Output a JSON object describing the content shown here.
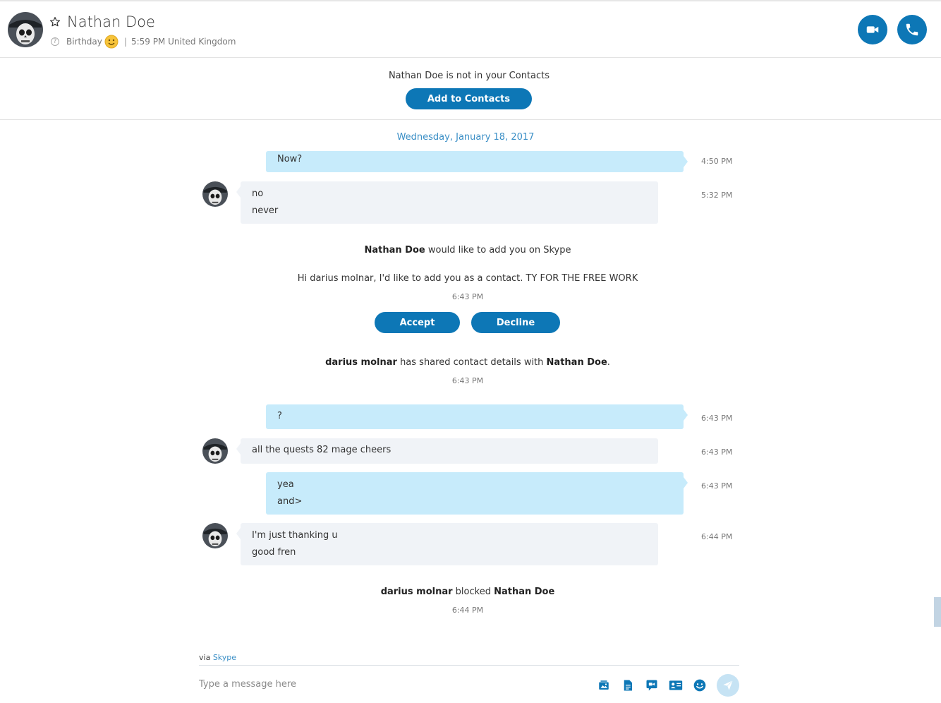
{
  "contact": {
    "name": "Nathan Doe",
    "status_label": "Birthday",
    "separator": "|",
    "local_time": "5:59 PM United Kingdom",
    "help_glyph": "?"
  },
  "banner": {
    "text": "Nathan Doe is not in your Contacts",
    "add_button": "Add to Contacts"
  },
  "date_separator": "Wednesday, January 18, 2017",
  "messages": [
    {
      "direction": "out",
      "lines": [
        "Now?"
      ],
      "time": "4:50 PM"
    },
    {
      "direction": "in",
      "lines": [
        "no",
        "never"
      ],
      "time": "5:32 PM"
    },
    {
      "direction": "out",
      "lines": [
        "?"
      ],
      "time": "6:43 PM"
    },
    {
      "direction": "in",
      "lines": [
        "all the quests 82 mage cheers"
      ],
      "time": "6:43 PM"
    },
    {
      "direction": "out",
      "lines": [
        "yea",
        "and>"
      ],
      "time": "6:43 PM"
    },
    {
      "direction": "in",
      "lines": [
        "I'm just thanking u",
        "good fren"
      ],
      "time": "6:44 PM"
    }
  ],
  "request": {
    "name": "Nathan Doe",
    "text": "would like to add you on Skype",
    "message": "Hi darius molnar, I'd like to add you as a contact. TY FOR THE FREE WORK",
    "time": "6:43 PM",
    "accept": "Accept",
    "decline": "Decline"
  },
  "shared": {
    "actor": "darius molnar",
    "text": "has shared contact details with",
    "target": "Nathan Doe",
    "period": ".",
    "time": "6:43 PM"
  },
  "blocked": {
    "actor": "darius molnar",
    "text": "blocked",
    "target": "Nathan Doe",
    "time": "6:44 PM"
  },
  "compose": {
    "via_label": "via",
    "via_link": "Skype",
    "placeholder": "Type a message here"
  },
  "icons": {
    "favorite": "star-outline-icon",
    "video": "video-camera-icon",
    "call": "phone-icon",
    "media": "media-gallery-icon",
    "file": "file-icon",
    "video_message": "video-message-icon",
    "contact_card": "contact-card-icon",
    "emoticon": "emoticon-icon",
    "send": "send-icon"
  },
  "colors": {
    "accent": "#0d77b6",
    "outgoing_bubble": "#c7ebfb",
    "incoming_bubble": "#f0f3f7",
    "link": "#3b8fc6"
  }
}
